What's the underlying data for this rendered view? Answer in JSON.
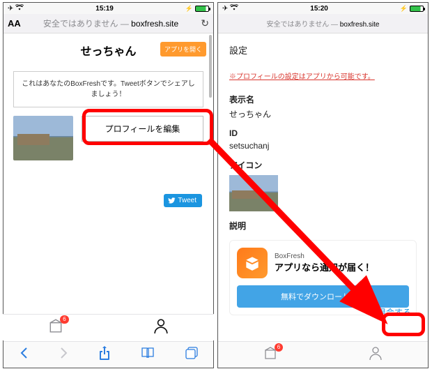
{
  "statusbar": {
    "time_left": "15:19",
    "time_right": "15:20"
  },
  "addressbar": {
    "not_secure": "安全ではありません",
    "separator": " — ",
    "site": "boxfresh.site",
    "aA": "AA"
  },
  "left": {
    "username": "せっちゃん",
    "open_app": "アプリを開く",
    "share_text": "これはあなたのBoxFreshです。Tweetボタンでシェアしましょう！",
    "edit_profile": "プロフィールを編集",
    "tweet": "Tweet"
  },
  "right": {
    "settings_title": "設定",
    "notice": "※プロフィールの設定はアプリから可能です。",
    "display_name_label": "表示名",
    "display_name_value": "せっちゃん",
    "id_label": "ID",
    "id_value": "setsuchanj",
    "icon_label": "アイコン",
    "desc_label": "説明",
    "promo_app": "BoxFresh",
    "promo_text": "アプリなら通知が届く！",
    "download": "無料でダウンロードする",
    "withdraw": "退会する"
  },
  "tabbar": {
    "badge": "6"
  }
}
